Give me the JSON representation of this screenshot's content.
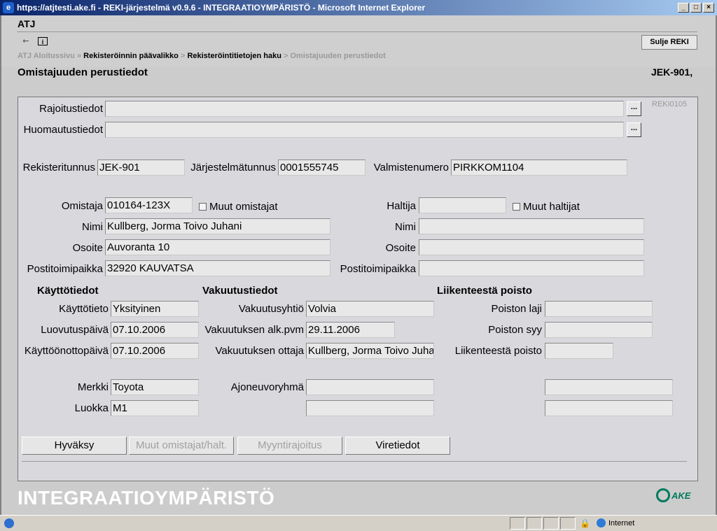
{
  "window": {
    "title": "https://atjtesti.ake.fi - REKI-järjestelmä v0.9.6 - INTEGRAATIOYMPÄRISTÖ - Microsoft Internet Explorer",
    "btn_min": "_",
    "btn_max": "□",
    "btn_close": "×"
  },
  "app": {
    "label": "ATJ",
    "close_button": "Sulje REKI",
    "form_code": "REKI0105",
    "env_banner": "INTEGRAATIOYMPÄRISTÖ",
    "logo_text": "AKE"
  },
  "breadcrumb": {
    "item1": "ATJ Aloitussivu",
    "sep": "»",
    "item2": "Rekisteröinnin päävalikko",
    "sep2": ">",
    "item3": "Rekisteröintitietojen haku",
    "item4": "Omistajuuden perustiedot"
  },
  "page": {
    "title": "Omistajuuden perustiedot",
    "reg": "JEK-901,"
  },
  "form": {
    "rajoitus_label": "Rajoitustiedot",
    "rajoitus_value": "",
    "huomautus_label": "Huomautustiedot",
    "huomautus_value": "",
    "dots": "...",
    "rekisteritunnus_label": "Rekisteritunnus",
    "rekisteritunnus_value": "JEK-901",
    "jarjestelmatunnus_label": "Järjestelmätunnus",
    "jarjestelmatunnus_value": "0001555745",
    "valmistenumero_label": "Valmistenumero",
    "valmistenumero_value": "PIRKKOM1104",
    "omistaja_label": "Omistaja",
    "omistaja_value": "010164-123X",
    "muut_omistajat": "Muut omistajat",
    "haltija_label": "Haltija",
    "haltija_value": "",
    "muut_haltijat": "Muut haltijat",
    "nimi_label": "Nimi",
    "nimi_value": "Kullberg, Jorma Toivo Juhani",
    "h_nimi_value": "",
    "osoite_label": "Osoite",
    "osoite_value": "Auvoranta 10",
    "h_osoite_value": "",
    "posti_label": "Postitoimipaikka",
    "posti_value": "32920 KAUVATSA",
    "h_posti_value": "",
    "kaytto_header": "Käyttötiedot",
    "vakuutus_header": "Vakuutustiedot",
    "poisto_header": "Liikenteestä poisto",
    "kayttotieto_label": "Käyttötieto",
    "kayttotieto_value": "Yksityinen",
    "luovutus_label": "Luovutuspäivä",
    "luovutus_value": "07.10.2006",
    "kayttoonotto_label": "Käyttöönottopäivä",
    "kayttoonotto_value": "07.10.2006",
    "vakuutusyhtio_label": "Vakuutusyhtiö",
    "vakuutusyhtio_value": "Volvia",
    "vak_alk_label": "Vakuutuksen alk.pvm",
    "vak_alk_value": "29.11.2006",
    "vak_ottaja_label": "Vakuutuksen ottaja",
    "vak_ottaja_value": "Kullberg, Jorma Toivo Juhani",
    "poiston_laji_label": "Poiston laji",
    "poiston_laji_value": "",
    "poiston_syy_label": "Poiston syy",
    "poiston_syy_value": "",
    "liik_poisto_label": "Liikenteestä poisto",
    "liik_poisto_value": "",
    "merkki_label": "Merkki",
    "merkki_value": "Toyota",
    "luokka_label": "Luokka",
    "luokka_value": "M1",
    "ajoneuvoryhma_label": "Ajoneuvoryhmä",
    "ajoneuvoryhma_value": "",
    "extra1_value": "",
    "extra2_value": "",
    "extra3_value": ""
  },
  "buttons": {
    "hyvaksy": "Hyväksy",
    "muut": "Muut omistajat/halt.",
    "myynti": "Myyntirajoitus",
    "vire": "Viretiedot"
  },
  "statusbar": {
    "zone": "Internet"
  }
}
